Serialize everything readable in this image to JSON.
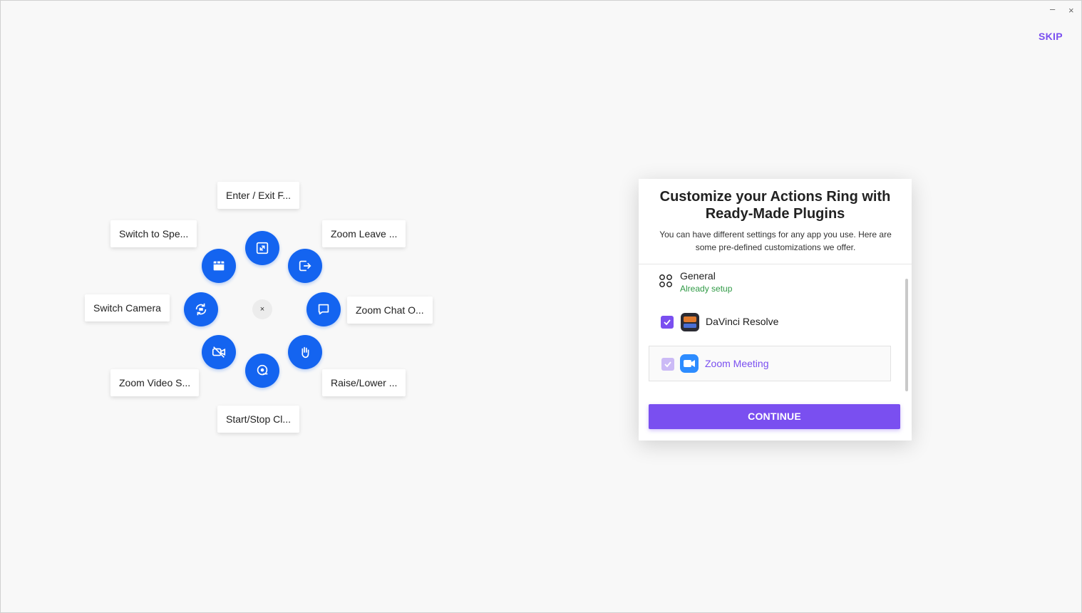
{
  "window": {
    "minimize_glyph": "–",
    "close_glyph": "×"
  },
  "header": {
    "skip_label": "SKIP"
  },
  "ring": {
    "center_glyph": "×",
    "labels": [
      "Enter / Exit F...",
      "Zoom Leave ...",
      "Zoom Chat O...",
      "Raise/Lower ...",
      "Start/Stop Cl...",
      "Zoom Video S...",
      "Switch Camera",
      "Switch to Spe..."
    ],
    "action_color": "#1464f0"
  },
  "panel": {
    "title_line1": "Customize your Actions Ring with",
    "title_line2": "Ready-Made Plugins",
    "subtitle": "You can have different settings for any app you use. Here are some pre-defined customizations we offer.",
    "items": [
      {
        "label": "General",
        "status": "Already setup",
        "icon": "general-grid-icon"
      },
      {
        "label": "DaVinci Resolve",
        "checked": true,
        "icon": "davinci-resolve-icon"
      },
      {
        "label": "Zoom Meeting",
        "checked": true,
        "icon": "zoom-icon"
      }
    ],
    "continue_label": "CONTINUE",
    "accent_color": "#7a4ff0",
    "status_color": "#2f9a45"
  }
}
